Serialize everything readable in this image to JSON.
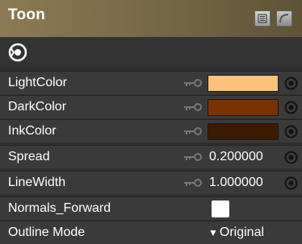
{
  "panel": {
    "title": "Toon"
  },
  "colors": {
    "title_gradient_left": "#8c7a54",
    "background": "#2e2e2e",
    "row_bg": "#3a3a3a"
  },
  "properties": [
    {
      "label": "LightColor",
      "type": "color",
      "value": "#ffc27a",
      "icons": [
        "key-icon",
        "bind-dot-icon"
      ]
    },
    {
      "label": "DarkColor",
      "type": "color",
      "value": "#7b3100",
      "icons": [
        "key-icon",
        "bind-dot-icon"
      ]
    },
    {
      "label": "InkColor",
      "type": "color",
      "value": "#3c1a02",
      "icons": [
        "key-icon",
        "bind-dot-icon"
      ]
    },
    {
      "label": "Spread",
      "type": "number",
      "value": "0.200000",
      "icons": [
        "key-icon",
        "bind-dot-icon"
      ]
    },
    {
      "label": "LineWidth",
      "type": "number",
      "value": "1.000000",
      "icons": [
        "key-icon",
        "bind-dot-icon"
      ]
    },
    {
      "label": "Normals_Forward",
      "type": "checkbox",
      "checked": false
    },
    {
      "label": "Outline Mode",
      "type": "dropdown",
      "value": "Original"
    }
  ]
}
